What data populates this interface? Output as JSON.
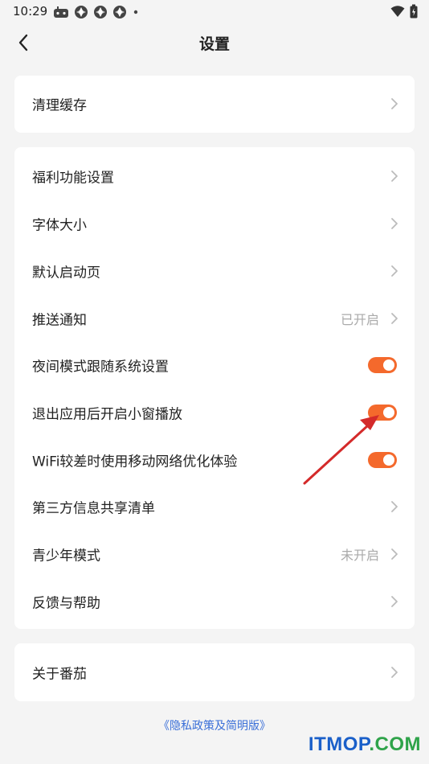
{
  "status_bar": {
    "time": "10:29",
    "left_icons": [
      "game-controller-icon",
      "app-icon",
      "app-icon",
      "app-icon",
      "dot-icon"
    ],
    "right_icons": [
      "wifi-icon",
      "battery-icon"
    ]
  },
  "nav": {
    "title": "设置",
    "back_icon": "chevron-left-icon"
  },
  "cards": [
    {
      "rows": [
        {
          "label": "清理缓存",
          "type": "link"
        }
      ]
    },
    {
      "rows": [
        {
          "label": "福利功能设置",
          "type": "link"
        },
        {
          "label": "字体大小",
          "type": "link"
        },
        {
          "label": "默认启动页",
          "type": "link"
        },
        {
          "label": "推送通知",
          "type": "link",
          "value": "已开启"
        },
        {
          "label": "夜间模式跟随系统设置",
          "type": "toggle",
          "on": true
        },
        {
          "label": "退出应用后开启小窗播放",
          "type": "toggle",
          "on": true
        },
        {
          "label": "WiFi较差时使用移动网络优化体验",
          "type": "toggle",
          "on": true
        },
        {
          "label": "第三方信息共享清单",
          "type": "link"
        },
        {
          "label": "青少年模式",
          "type": "link",
          "value": "未开启"
        },
        {
          "label": "反馈与帮助",
          "type": "link"
        }
      ]
    },
    {
      "rows": [
        {
          "label": "关于番茄",
          "type": "link"
        }
      ]
    }
  ],
  "footer": {
    "privacy_link": "《隐私政策及简明版》"
  },
  "watermark": {
    "part1": "ITMOP",
    "part2": ".COM"
  },
  "colors": {
    "accent": "#f4692c",
    "background": "#f4f4f4",
    "card": "#ffffff",
    "link": "#3a6fd8",
    "annotation_arrow": "#d42a2a",
    "watermark_blue": "#1a5fc9",
    "watermark_green": "#2fa34a"
  }
}
